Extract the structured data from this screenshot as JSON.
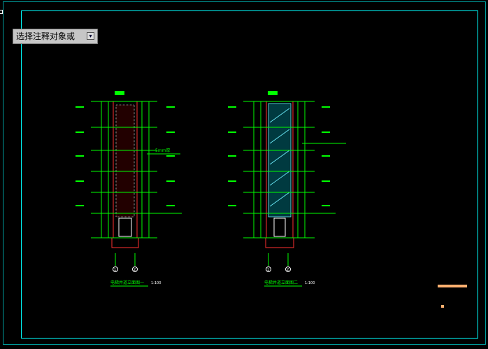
{
  "tooltip": {
    "label": "选择注释对象或",
    "dropdown_glyph": "▾"
  },
  "drawings": {
    "left_title": "电梯井道立面图一",
    "left_scale": "1:100",
    "right_title": "电梯井道立面图二",
    "right_scale": "1:100",
    "annotation_note": "5mm厚",
    "axis_labels": [
      "1",
      "2"
    ]
  },
  "colors": {
    "frame": "#00ffff",
    "line_green": "#00ff00",
    "line_red": "#ff3030",
    "line_white": "#ffffff",
    "accent_orange": "#ffb070",
    "glass_cyan": "#6ef0ff"
  }
}
